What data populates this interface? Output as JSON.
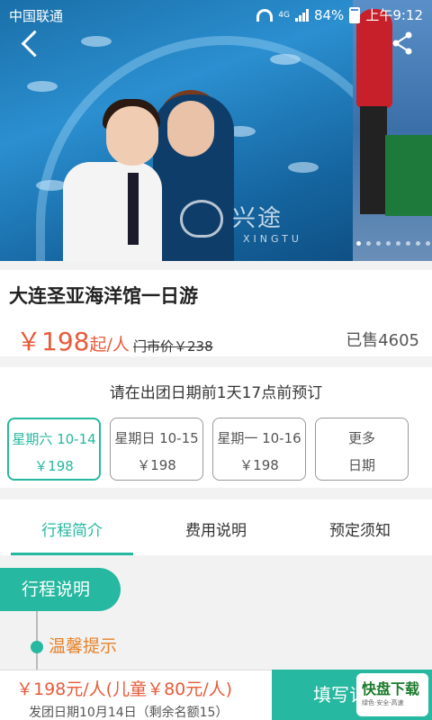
{
  "status_bar": {
    "carrier": "中国联通",
    "network": "4G",
    "battery": "84%",
    "time": "上午9:12"
  },
  "hero": {
    "watermark_cn": "兴途",
    "watermark_en": "XINGTU",
    "carousel_count": 8,
    "carousel_active": 0
  },
  "product": {
    "title": "大连圣亚海洋馆一日游",
    "price": "￥198",
    "price_unit": "起/人",
    "market_price": "门市价￥238",
    "sold": "已售4605"
  },
  "booking": {
    "notice": "请在出团日期前1天17点前预订",
    "dates": [
      {
        "line1": "星期六 10-14",
        "line2": "￥198",
        "selected": true
      },
      {
        "line1": "星期日 10-15",
        "line2": "￥198",
        "selected": false
      },
      {
        "line1": "星期一 10-16",
        "line2": "￥198",
        "selected": false
      },
      {
        "line1": "更多",
        "line2": "日期",
        "selected": false
      }
    ]
  },
  "tabs": [
    "行程简介",
    "费用说明",
    "预定须知"
  ],
  "itinerary": {
    "section_title": "行程说明",
    "tip_label": "温馨提示"
  },
  "bottom_bar": {
    "price_text": "￥198元/人(儿童￥80元/人)",
    "date_text": "发团日期10月14日（剩余名额15）",
    "cta": "填写订单",
    "badge_main": "快盘下载",
    "badge_sub": "绿色·安全·高速"
  },
  "colors": {
    "accent": "#26b8a0",
    "price": "#e85a3a",
    "tip": "#e8822a"
  },
  "icons": [
    "back-arrow-icon",
    "share-icon",
    "wifi-icon",
    "signal-icon",
    "battery-icon"
  ]
}
